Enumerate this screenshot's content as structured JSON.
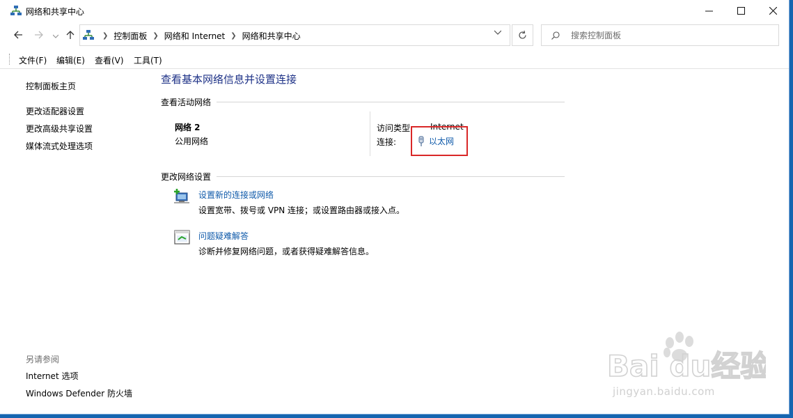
{
  "window": {
    "title": "网络和共享中心"
  },
  "navigation": {
    "breadcrumbs": [
      "控制面板",
      "网络和 Internet",
      "网络和共享中心"
    ],
    "search_placeholder": "搜索控制面板"
  },
  "menu": {
    "items": [
      "文件(F)",
      "编辑(E)",
      "查看(V)",
      "工具(T)"
    ]
  },
  "sidebar": {
    "home": "控制面板主页",
    "links": [
      "更改适配器设置",
      "更改高级共享设置",
      "媒体流式处理选项"
    ],
    "see_also_heading": "另请参阅",
    "see_also": [
      "Internet 选项",
      "Windows Defender 防火墙"
    ]
  },
  "main": {
    "title": "查看基本网络信息并设置连接",
    "active_networks_heading": "查看活动网络",
    "network": {
      "name": "网络 2",
      "type": "公用网络",
      "access_type_label": "访问类型:",
      "access_type_value": "Internet",
      "connection_label": "连接:",
      "connection_value": "以太网"
    },
    "change_settings_heading": "更改网络设置",
    "tasks": [
      {
        "link": "设置新的连接或网络",
        "desc": "设置宽带、拨号或 VPN 连接；或设置路由器或接入点。"
      },
      {
        "link": "问题疑难解答",
        "desc": "诊断并修复网络问题，或者获得疑难解答信息。"
      }
    ]
  },
  "watermark": {
    "logo_text": "Baidu经验",
    "url": "jingyan.baidu.com"
  },
  "colors": {
    "link": "#0f5aaa",
    "title": "#1e3287",
    "highlight": "#d92727",
    "desktop": "#1565b0"
  }
}
